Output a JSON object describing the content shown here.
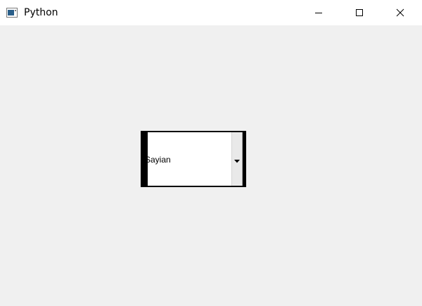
{
  "window": {
    "title": "Python",
    "icon": "python-app-icon"
  },
  "titlebar_buttons": {
    "minimize": "minimize-icon",
    "maximize": "maximize-icon",
    "close": "close-icon"
  },
  "combobox": {
    "value": "Sayian",
    "arrow": "dropdown-arrow-icon"
  },
  "colors": {
    "background": "#f0f0f0",
    "titlebar": "#ffffff",
    "combo_border": "#000000"
  }
}
